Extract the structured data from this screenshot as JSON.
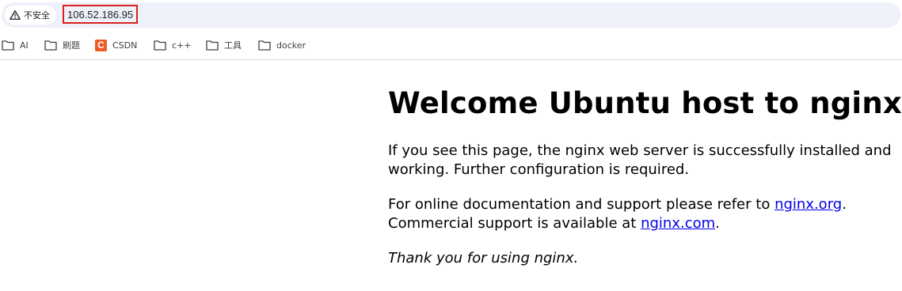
{
  "address_bar": {
    "security_label": "不安全",
    "url": "106.52.186.95"
  },
  "bookmarks": [
    {
      "label": "AI",
      "icon": "folder-icon"
    },
    {
      "label": "刷题",
      "icon": "folder-icon"
    },
    {
      "label": "CSDN",
      "icon": "csdn-icon",
      "icon_letter": "C"
    },
    {
      "label": "c++",
      "icon": "folder-icon"
    },
    {
      "label": "工具",
      "icon": "folder-icon"
    },
    {
      "label": "docker",
      "icon": "folder-icon"
    }
  ],
  "page": {
    "heading": "Welcome Ubuntu host to nginx!",
    "p1": "If you see this page, the nginx web server is successfully installed and working. Further configuration is required.",
    "p2_before": "For online documentation and support please refer to ",
    "p2_link1": "nginx.org",
    "p2_mid": ".",
    "p2_line2": "Commercial support is available at ",
    "p2_link2": "nginx.com",
    "p2_end": ".",
    "p3": "Thank you for using nginx."
  },
  "colors": {
    "link": "#0000ee",
    "url_highlight_border": "#d9221c",
    "csdn_brand": "#f05a28",
    "omnibox_bg": "#eef1f9"
  }
}
